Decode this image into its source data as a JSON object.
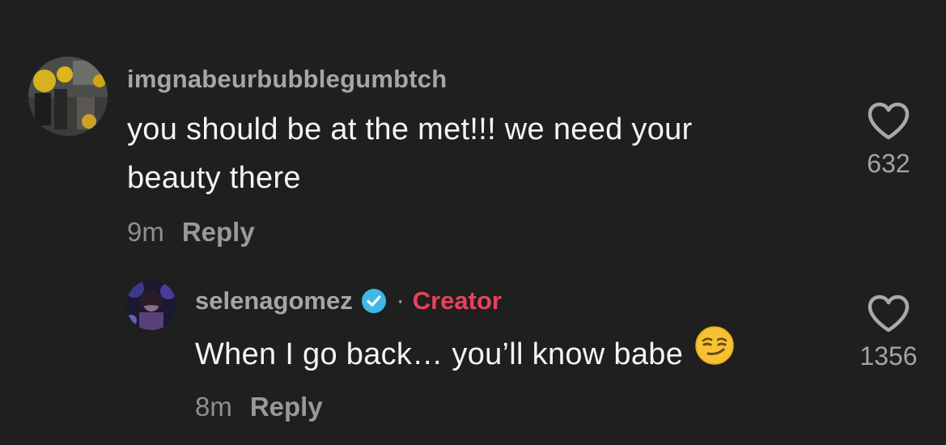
{
  "comments": [
    {
      "username": "imgnabeurbubblegumbtch",
      "text_line1": "you should be at the met!!! we need your",
      "text_line2": "beauty there",
      "time": "9m",
      "reply_label": "Reply",
      "likes": "632",
      "icon": "heart-outline-icon"
    }
  ],
  "reply": {
    "username": "selenagomez",
    "verified_icon": "verified-badge-icon",
    "separator": "·",
    "creator_label": "Creator",
    "text": "When I go back… you’ll know babe",
    "emoji": "smirking-face-emoji",
    "time": "8m",
    "reply_label": "Reply",
    "likes": "1356",
    "icon": "heart-outline-icon"
  },
  "colors": {
    "background": "#1f1f1f",
    "username": "#a6a6a6",
    "creator": "#e8425a",
    "verified": "#3fb8e8"
  }
}
